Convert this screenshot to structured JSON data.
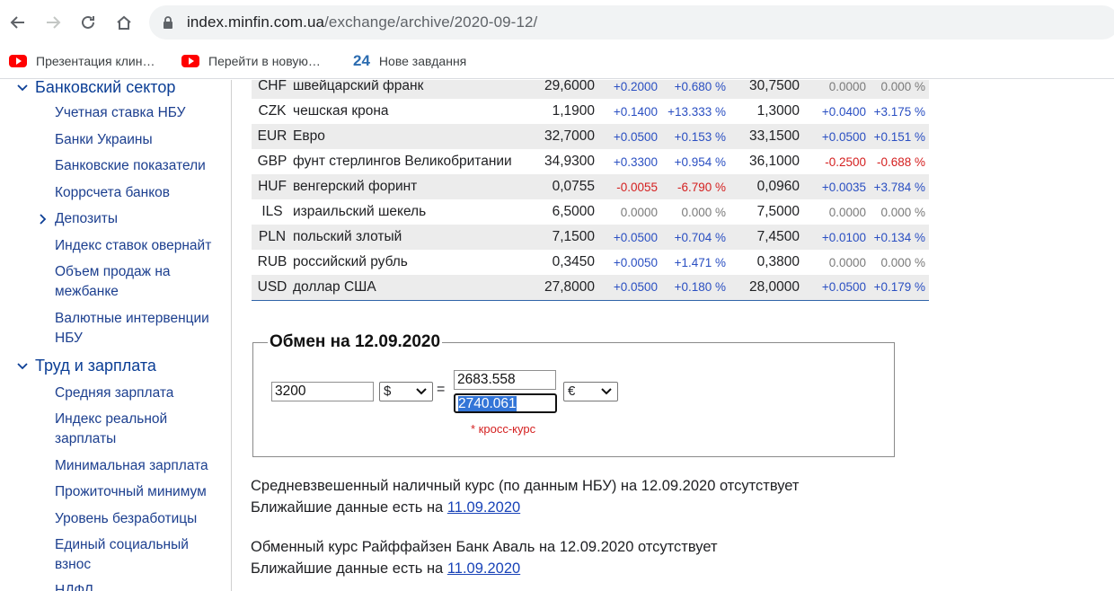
{
  "browser": {
    "url_host": "index.minfin.com.ua",
    "url_path": "/exchange/archive/2020-09-12/",
    "bookmarks": [
      "Презентация клин…",
      "Перейти в новую…",
      "Нове завдання"
    ],
    "bookmark_24": "24"
  },
  "sidebar": {
    "section_bank": "Банковский сектор",
    "bank_items": [
      "Учетная ставка НБУ",
      "Банки Украины",
      "Банковские показатели",
      "Коррсчета банков",
      "Депозиты",
      "Индекс ставок овернайт",
      "Объем продаж на межбанке",
      "Валютные интервенции НБУ"
    ],
    "section_labor": "Труд и зарплата",
    "labor_items": [
      "Средняя зарплата",
      "Индекс реальной зарплаты",
      "Минимальная зарплата",
      "Прожиточный минимум",
      "Уровень безработицы",
      "Единый социальный взнос",
      "НДФЛ"
    ]
  },
  "rates": [
    {
      "code": "CHF",
      "name": "швейцарский франк",
      "buy": "29,6000",
      "buy_ch": "+0.2000",
      "buy_pct": "+0.680 %",
      "sell": "30,7500",
      "sell_ch": "0.0000",
      "sell_pct": "0.000 %"
    },
    {
      "code": "CZK",
      "name": "чешская крона",
      "buy": "1,1900",
      "buy_ch": "+0.1400",
      "buy_pct": "+13.333 %",
      "sell": "1,3000",
      "sell_ch": "+0.0400",
      "sell_pct": "+3.175 %"
    },
    {
      "code": "EUR",
      "name": "Евро",
      "buy": "32,7000",
      "buy_ch": "+0.0500",
      "buy_pct": "+0.153 %",
      "sell": "33,1500",
      "sell_ch": "+0.0500",
      "sell_pct": "+0.151 %"
    },
    {
      "code": "GBP",
      "name": "фунт стерлингов Великобритании",
      "buy": "34,9300",
      "buy_ch": "+0.3300",
      "buy_pct": "+0.954 %",
      "sell": "36,1000",
      "sell_ch": "-0.2500",
      "sell_pct": "-0.688 %"
    },
    {
      "code": "HUF",
      "name": "венгерский форинт",
      "buy": "0,0755",
      "buy_ch": "-0.0055",
      "buy_pct": "-6.790 %",
      "sell": "0,0960",
      "sell_ch": "+0.0035",
      "sell_pct": "+3.784 %"
    },
    {
      "code": "ILS",
      "name": "израильский шекель",
      "buy": "6,5000",
      "buy_ch": "0.0000",
      "buy_pct": "0.000 %",
      "sell": "7,5000",
      "sell_ch": "0.0000",
      "sell_pct": "0.000 %"
    },
    {
      "code": "PLN",
      "name": "польский злотый",
      "buy": "7,1500",
      "buy_ch": "+0.0500",
      "buy_pct": "+0.704 %",
      "sell": "7,4500",
      "sell_ch": "+0.0100",
      "sell_pct": "+0.134 %"
    },
    {
      "code": "RUB",
      "name": "российский рубль",
      "buy": "0,3450",
      "buy_ch": "+0.0050",
      "buy_pct": "+1.471 %",
      "sell": "0,3800",
      "sell_ch": "0.0000",
      "sell_pct": "0.000 %"
    },
    {
      "code": "USD",
      "name": "доллар США",
      "buy": "27,8000",
      "buy_ch": "+0.0500",
      "buy_pct": "+0.180 %",
      "sell": "28,0000",
      "sell_ch": "+0.0500",
      "sell_pct": "+0.179 %"
    }
  ],
  "exchange": {
    "title": "Обмен на 12.09.2020",
    "amount": "3200",
    "from_currency": "$",
    "equals": "=",
    "result_1": "2683.558",
    "result_2": "2740.061",
    "to_currency": "€",
    "cross_note": "* кросс-курс"
  },
  "notes": [
    {
      "text": "Средневзвешенный наличный курс (по данным НБУ) на 12.09.2020 отсутствует",
      "nearest_label": "Ближайшие данные есть на",
      "nearest_link": "11.09.2020"
    },
    {
      "text": "Обменный курс Райффайзен Банк Аваль на 12.09.2020 отсутствует",
      "nearest_label": "Ближайшие данные есть на",
      "nearest_link": "11.09.2020"
    }
  ],
  "colors": {
    "link": "#1c3f8f",
    "positive": "#2a4fc2",
    "negative": "#d42020",
    "row_stripe": "#ececec"
  }
}
